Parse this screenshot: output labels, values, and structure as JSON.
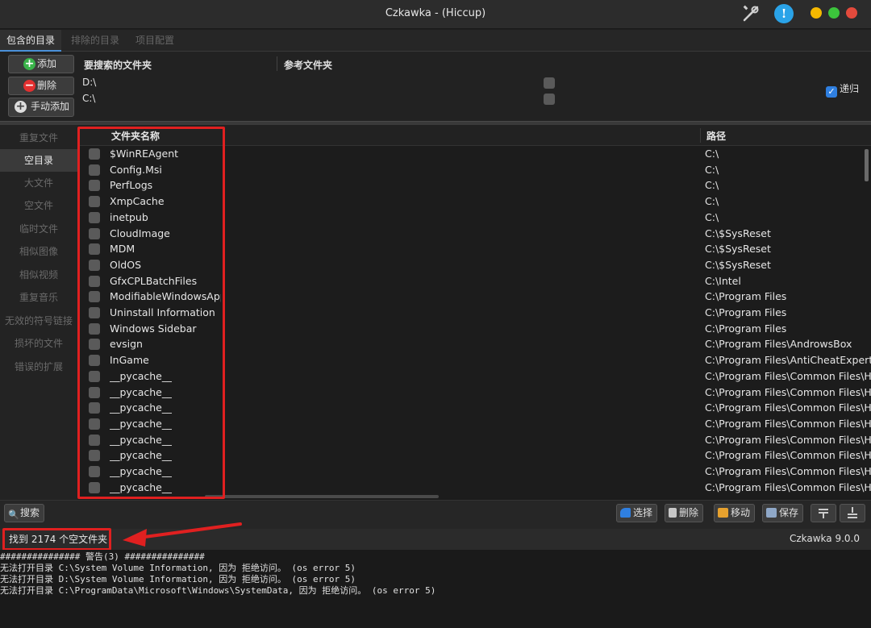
{
  "window": {
    "title": "Czkawka - (Hiccup)"
  },
  "tabs": [
    {
      "label": "包含的目录"
    },
    {
      "label": "排除的目录"
    },
    {
      "label": "项目配置"
    }
  ],
  "dir_panel": {
    "add_label": "添加",
    "remove_label": "删除",
    "manual_add_label": "手动添加",
    "search_dirs_header": "要搜索的文件夹",
    "ref_dirs_header": "参考文件夹",
    "dirs": [
      "D:\\",
      "C:\\"
    ],
    "recursive_label": "递归"
  },
  "sidenav": [
    {
      "label": "重复文件"
    },
    {
      "label": "空目录"
    },
    {
      "label": "大文件"
    },
    {
      "label": "空文件"
    },
    {
      "label": "临时文件"
    },
    {
      "label": "相似图像"
    },
    {
      "label": "相似视频"
    },
    {
      "label": "重复音乐"
    },
    {
      "label": "无效的符号链接"
    },
    {
      "label": "损坏的文件"
    },
    {
      "label": "错误的扩展"
    }
  ],
  "list": {
    "name_header": "文件夹名称",
    "path_header": "路径",
    "rows": [
      {
        "name": "$WinREAgent",
        "path": "C:\\"
      },
      {
        "name": "Config.Msi",
        "path": "C:\\"
      },
      {
        "name": "PerfLogs",
        "path": "C:\\"
      },
      {
        "name": "XmpCache",
        "path": "C:\\"
      },
      {
        "name": "inetpub",
        "path": "C:\\"
      },
      {
        "name": "CloudImage",
        "path": "C:\\$SysReset"
      },
      {
        "name": "MDM",
        "path": "C:\\$SysReset"
      },
      {
        "name": "OldOS",
        "path": "C:\\$SysReset"
      },
      {
        "name": "GfxCPLBatchFiles",
        "path": "C:\\Intel"
      },
      {
        "name": "ModifiableWindowsApp",
        "path": "C:\\Program Files"
      },
      {
        "name": "Uninstall Information",
        "path": "C:\\Program Files"
      },
      {
        "name": "Windows Sidebar",
        "path": "C:\\Program Files"
      },
      {
        "name": "evsign",
        "path": "C:\\Program Files\\AndrowsBox"
      },
      {
        "name": "InGame",
        "path": "C:\\Program Files\\AntiCheatExpert"
      },
      {
        "name": "__pycache__",
        "path": "C:\\Program Files\\Common Files\\HFC"
      },
      {
        "name": "__pycache__",
        "path": "C:\\Program Files\\Common Files\\HFC"
      },
      {
        "name": "__pycache__",
        "path": "C:\\Program Files\\Common Files\\HFC"
      },
      {
        "name": "__pycache__",
        "path": "C:\\Program Files\\Common Files\\HFC"
      },
      {
        "name": "__pycache__",
        "path": "C:\\Program Files\\Common Files\\HFC"
      },
      {
        "name": "__pycache__",
        "path": "C:\\Program Files\\Common Files\\HFC"
      },
      {
        "name": "__pycache__",
        "path": "C:\\Program Files\\Common Files\\HFC"
      },
      {
        "name": "__pycache__",
        "path": "C:\\Program Files\\Common Files\\HFC"
      }
    ]
  },
  "bottombar": {
    "search_label": "搜索",
    "select_label": "选择",
    "delete_label": "删除",
    "move_label": "移动",
    "save_label": "保存"
  },
  "status": {
    "found_text": "找到 2174 个空文件夹",
    "version": "Czkawka 9.0.0"
  },
  "log": [
    "############### 警告(3) ###############",
    "无法打开目录 C:\\System Volume Information, 因为 拒绝访问。 (os error 5)",
    "无法打开目录 D:\\System Volume Information, 因为 拒绝访问。 (os error 5)",
    "无法打开目录 C:\\ProgramData\\Microsoft\\Windows\\SystemData, 因为 拒绝访问。 (os error 5)"
  ],
  "colors": {
    "accent": "#4a90d9",
    "annotation_red": "#e02020"
  }
}
